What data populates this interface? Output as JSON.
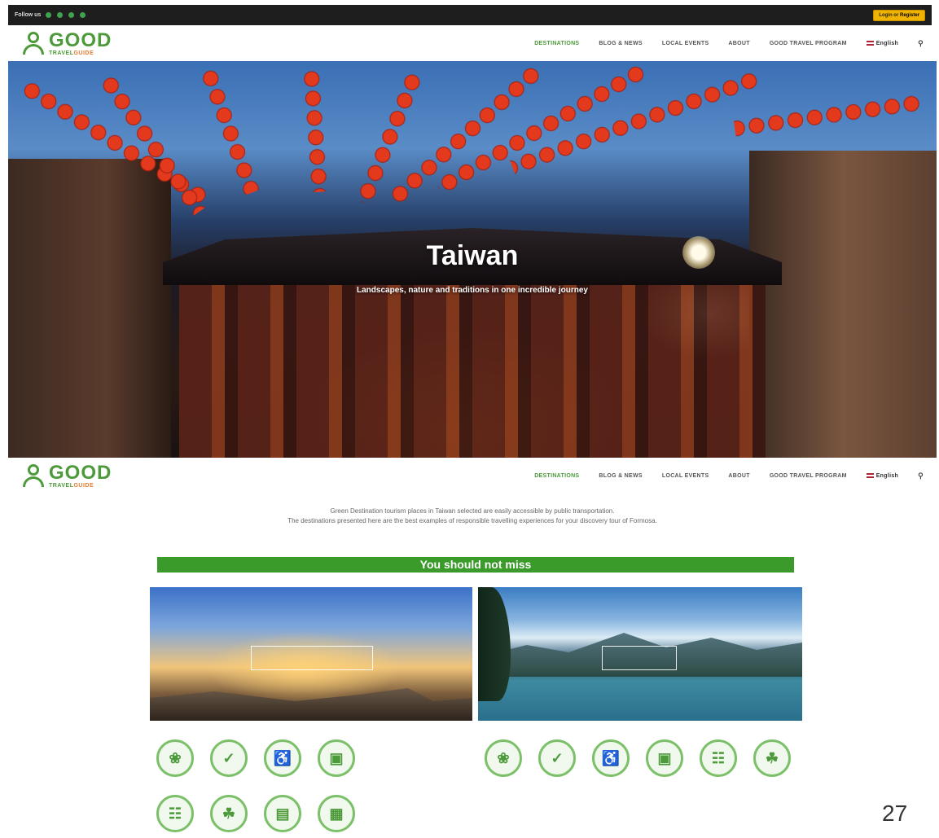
{
  "topbar": {
    "follow_label": "Follow us",
    "socials": [
      "facebook-icon",
      "instagram-icon",
      "linkedin-icon",
      "youtube-icon"
    ],
    "login_prefix": "Login or",
    "login_action": "Register"
  },
  "logo": {
    "brand": "GOOD",
    "sub_a": "TRAVEL",
    "sub_b": "GUIDE"
  },
  "nav": {
    "items": [
      "DESTINATIONS",
      "BLOG & NEWS",
      "LOCAL EVENTS",
      "ABOUT",
      "GOOD TRAVEL PROGRAM"
    ],
    "language": "English",
    "search_icon": "search-icon"
  },
  "hero": {
    "title": "Taiwan",
    "subtitle": "Landscapes, nature and traditions in one incredible journey"
  },
  "intro": {
    "line1": "Green Destination tourism places in Taiwan selected are easily accessible by public transportation.",
    "line2": "The destinations presented here are the best examples of responsible travelling experiences for your discovery tour of Formosa."
  },
  "banner": {
    "label": "You should not miss"
  },
  "cards": [
    {
      "cta": "",
      "icons": [
        "hands-leaf-icon",
        "shield-check-icon",
        "wheelchair-icon",
        "bus-icon"
      ],
      "icons_row2": [
        "museum-icon",
        "island-icon",
        "chart-icon",
        "map-icon"
      ]
    },
    {
      "cta": "",
      "icons": [
        "hands-leaf-icon",
        "shield-check-icon",
        "wheelchair-icon",
        "bus-icon",
        "museum-icon",
        "cactus-icon"
      ]
    }
  ],
  "colors": {
    "brand_green": "#4c9a3a",
    "banner_green": "#3a9a2a",
    "accent_orange": "#e67b2e",
    "login_yellow": "#f0b400"
  },
  "page_number": "27"
}
